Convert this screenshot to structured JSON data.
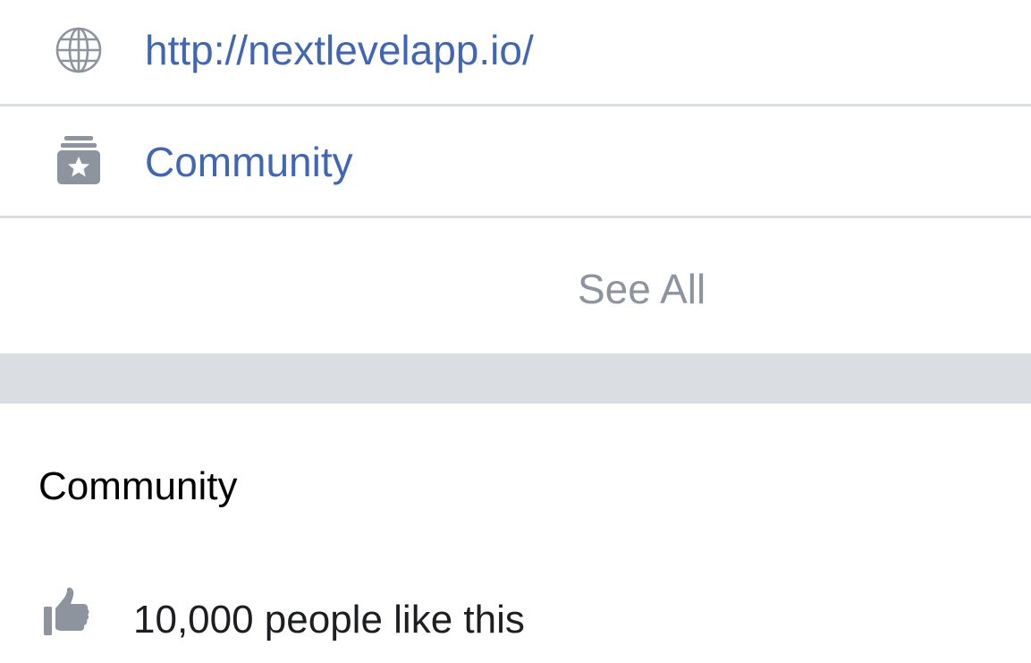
{
  "about": {
    "website": {
      "icon": "globe-icon",
      "url": "http://nextlevelapp.io/"
    },
    "category": {
      "icon": "category-star-icon",
      "label": "Community"
    },
    "see_all_label": "See All"
  },
  "community": {
    "title": "Community",
    "likes": {
      "icon": "thumbs-up-icon",
      "text": "10,000 people like this"
    }
  },
  "colors": {
    "link": "#4267b2",
    "muted": "#8d949e",
    "icon": "#8d949e",
    "divider": "#dadde1",
    "section_gap": "#dadde1",
    "text": "#1c1e21"
  }
}
